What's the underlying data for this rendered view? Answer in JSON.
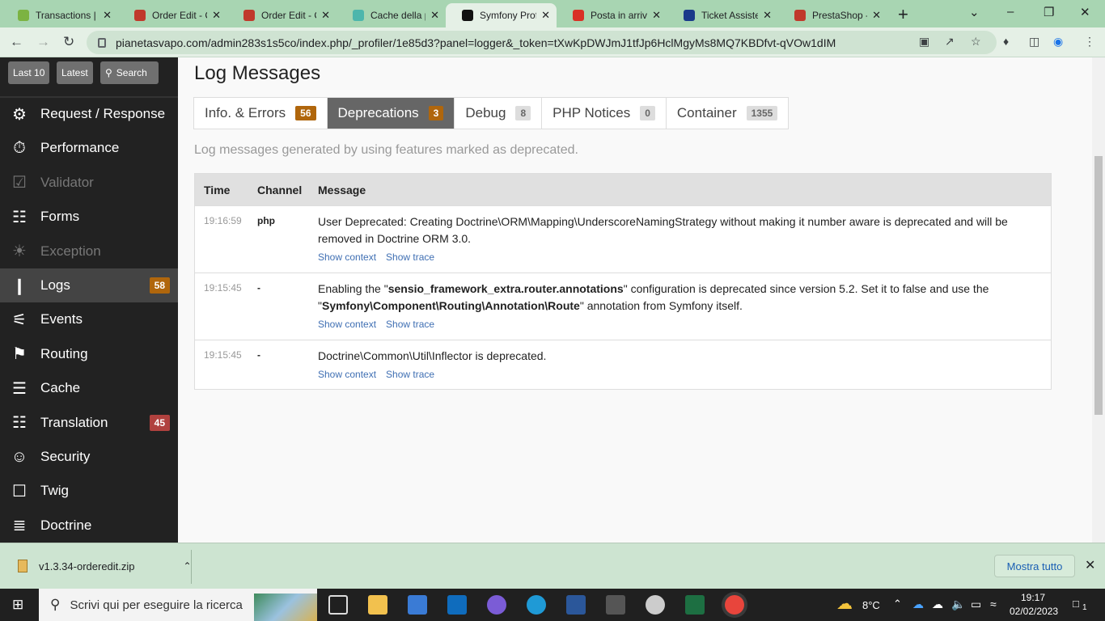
{
  "browser": {
    "tabs": [
      {
        "title": "Transactions |",
        "color": "#7cb342"
      },
      {
        "title": "Order Edit - C",
        "color": "#c0392b"
      },
      {
        "title": "Order Edit - C",
        "color": "#c0392b"
      },
      {
        "title": "Cache della p",
        "color": "#4db6ac"
      },
      {
        "title": "Symfony Prof",
        "color": "#111111"
      },
      {
        "title": "Posta in arriv",
        "color": "#d93025"
      },
      {
        "title": "Ticket Assiste",
        "color": "#1a3a8a"
      },
      {
        "title": "PrestaShop -",
        "color": "#c0392b"
      }
    ],
    "url": "pianetasvapo.com/admin283s1s5co/index.php/_profiler/1e85d3?panel=logger&_token=tXwKpDWJmJ1tfJp6HclMgyMs8MQ7KBDfvt-qVOw1dIM"
  },
  "sidebar": {
    "buttons": [
      "Last 10",
      "Latest",
      "Search"
    ],
    "items": [
      {
        "label": "Request / Response",
        "icon": "gears-icon",
        "state": ""
      },
      {
        "label": "Performance",
        "icon": "stopwatch-icon",
        "state": ""
      },
      {
        "label": "Validator",
        "icon": "checkbox-icon",
        "state": "dis"
      },
      {
        "label": "Forms",
        "icon": "form-icon",
        "state": ""
      },
      {
        "label": "Exception",
        "icon": "fire-icon",
        "state": "dis"
      },
      {
        "label": "Logs",
        "icon": "logs-icon",
        "state": "sel",
        "count": "58",
        "count_color": "#b0660c"
      },
      {
        "label": "Events",
        "icon": "events-icon",
        "state": ""
      },
      {
        "label": "Routing",
        "icon": "routing-icon",
        "state": ""
      },
      {
        "label": "Cache",
        "icon": "cache-icon",
        "state": ""
      },
      {
        "label": "Translation",
        "icon": "translation-icon",
        "state": "",
        "count": "45",
        "count_color": "#b0413e"
      },
      {
        "label": "Security",
        "icon": "user-icon",
        "state": ""
      },
      {
        "label": "Twig",
        "icon": "twig-icon",
        "state": ""
      },
      {
        "label": "Doctrine",
        "icon": "database-icon",
        "state": ""
      }
    ]
  },
  "main": {
    "title": "Log Messages",
    "tabs": [
      {
        "label": "Info. & Errors",
        "count": "56",
        "active": false,
        "warn": true
      },
      {
        "label": "Deprecations",
        "count": "3",
        "active": true,
        "warn": true
      },
      {
        "label": "Debug",
        "count": "8",
        "active": false,
        "warn": false
      },
      {
        "label": "PHP Notices",
        "count": "0",
        "active": false,
        "warn": false
      },
      {
        "label": "Container",
        "count": "1355",
        "active": false,
        "warn": false
      }
    ],
    "description": "Log messages generated by using features marked as deprecated.",
    "columns": [
      "Time",
      "Channel",
      "Message"
    ],
    "rows": [
      {
        "time": "19:16:59",
        "channel": "php",
        "message_html": "User Deprecated: Creating Doctrine\\ORM\\Mapping\\UnderscoreNamingStrategy without making it number aware is deprecated and will be removed in Doctrine ORM 3.0.",
        "height": 83
      },
      {
        "time": "19:15:45",
        "channel": "-",
        "msg_parts": [
          "Enabling the \"",
          "sensio_framework_extra.router.annotations",
          "\" configuration is deprecated since version 5.2. Set it to false and use the \"",
          "Symfony\\Component\\Routing\\Annotation\\Route",
          "\" annotation from Symfony itself."
        ],
        "height": 83
      },
      {
        "time": "19:15:45",
        "channel": "-",
        "message_html": "Doctrine\\Common\\Util\\Inflector is deprecated.",
        "height": 61
      }
    ],
    "show_context": "Show context",
    "show_trace": "Show trace"
  },
  "download": {
    "file": "v1.3.34-orderedit.zip",
    "show_all": "Mostra tutto"
  },
  "taskbar": {
    "search_placeholder": "Scrivi qui per eseguire la ricerca",
    "temperature": "8°C",
    "time": "19:17",
    "date": "02/02/2023",
    "notifications": "1"
  }
}
